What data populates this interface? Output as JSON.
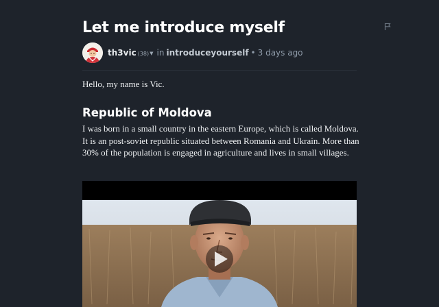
{
  "post": {
    "title": "Let me introduce myself",
    "author": "th3vic",
    "reputation": "(38)",
    "in_label": "in",
    "community": "introduceyourself",
    "separator": "•",
    "time_ago": "3 days ago"
  },
  "content": {
    "greeting": "Hello, my name is Vic.",
    "section_heading": "Republic of Moldova",
    "paragraph": "I was born in a small country in the eastern Europe, which is called Moldova. It is an post-soviet republic situated between Romania and Ukrain. More than 30% of the population is engaged in agriculture and lives in small villages."
  },
  "icons": {
    "flag": "flag-icon",
    "caret": "caret-down-icon",
    "play": "play-icon"
  },
  "colors": {
    "background": "#1e232b",
    "title": "#ffffff",
    "muted": "#8e9aa8"
  }
}
